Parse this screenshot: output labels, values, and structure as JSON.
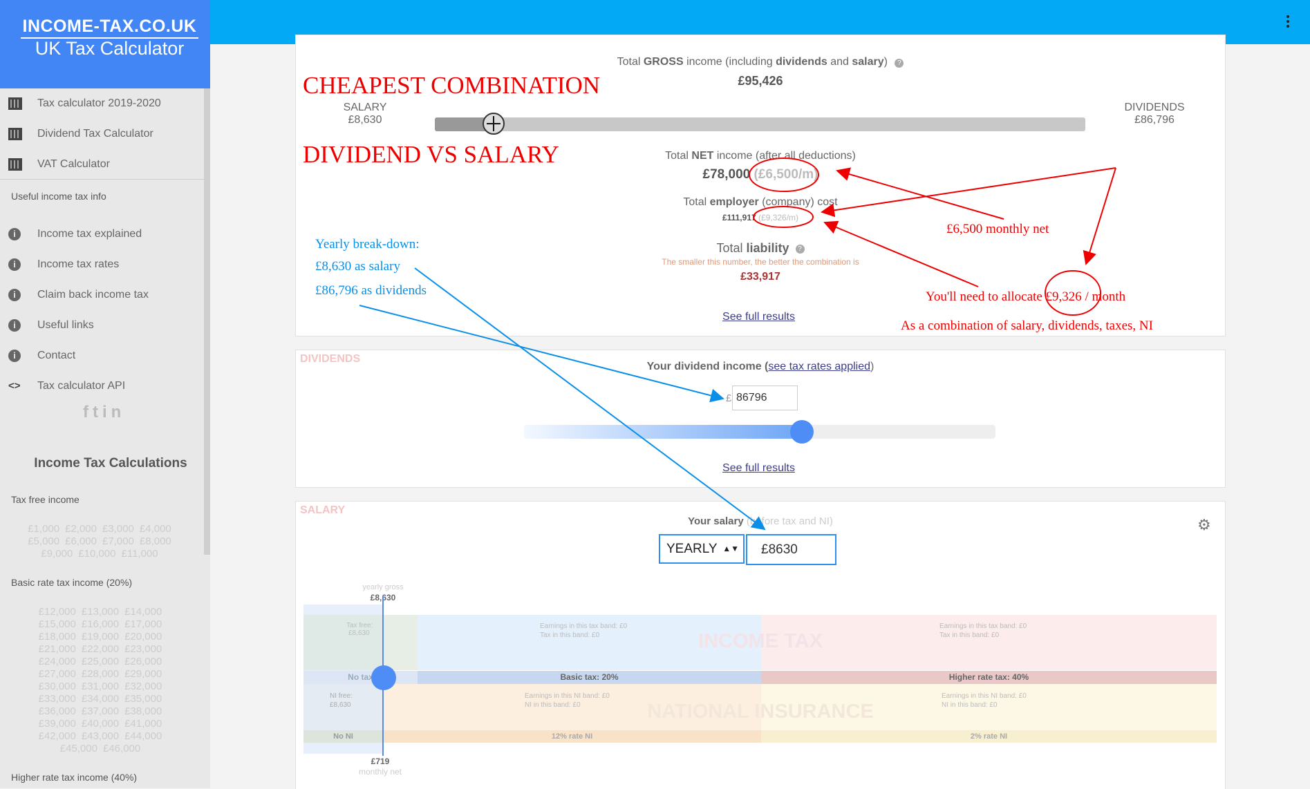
{
  "brand": {
    "line1": "INCOME-TAX.CO.UK",
    "line2": "UK Tax Calculator"
  },
  "nav": {
    "items": [
      {
        "label": "Tax calculator 2019-2020",
        "icon": "building-icon"
      },
      {
        "label": "Dividend Tax Calculator",
        "icon": "building-icon"
      },
      {
        "label": "VAT Calculator",
        "icon": "building-icon"
      }
    ],
    "section_label": "Useful income tax info",
    "info_items": [
      {
        "label": "Income tax explained",
        "icon": "info-icon"
      },
      {
        "label": "Income tax rates",
        "icon": "info-icon"
      },
      {
        "label": "Claim back income tax",
        "icon": "info-icon"
      },
      {
        "label": "Useful links",
        "icon": "info-icon"
      },
      {
        "label": "Contact",
        "icon": "info-icon"
      },
      {
        "label": "Tax calculator API",
        "icon": "code-icon"
      }
    ]
  },
  "sidebar": {
    "calc_title": "Income Tax Calculations",
    "tax_free_label": "Tax free income",
    "tax_free_amounts": [
      "£1,000",
      "£2,000",
      "£3,000",
      "£4,000",
      "£5,000",
      "£6,000",
      "£7,000",
      "£8,000",
      "£9,000",
      "£10,000",
      "£11,000"
    ],
    "basic_label": "Basic rate tax income (20%)",
    "basic_amounts": [
      "£12,000",
      "£13,000",
      "£14,000",
      "£15,000",
      "£16,000",
      "£17,000",
      "£18,000",
      "£19,000",
      "£20,000",
      "£21,000",
      "£22,000",
      "£23,000",
      "£24,000",
      "£25,000",
      "£26,000",
      "£27,000",
      "£28,000",
      "£29,000",
      "£30,000",
      "£31,000",
      "£32,000",
      "£33,000",
      "£34,000",
      "£35,000",
      "£36,000",
      "£37,000",
      "£38,000",
      "£39,000",
      "£40,000",
      "£41,000",
      "£42,000",
      "£43,000",
      "£44,000",
      "£45,000",
      "£46,000"
    ],
    "higher_label": "Higher rate tax income (40%)"
  },
  "summary": {
    "gross_pre": "Total ",
    "gross_bold": "GROSS",
    "gross_mid": " income (including ",
    "gross_b2": "dividends",
    "gross_and": " and ",
    "gross_b3": "salary",
    "gross_post": ")",
    "gross_value": "£95,426",
    "salary_label": "SALARY",
    "salary_value": "£8,630",
    "dividends_label": "DIVIDENDS",
    "dividends_value": "£86,796",
    "split_fraction": 0.09,
    "net_pre": "Total ",
    "net_bold": "NET",
    "net_post": " income (after all deductions)",
    "net_value": "£78,000",
    "net_monthly": "(£6,500/m)",
    "employer_pre": "Total ",
    "employer_bold": "employer",
    "employer_post": " (company) cost",
    "employer_value": "£111,917",
    "employer_monthly": "(£9,326/m)",
    "liability_pre": "Total ",
    "liability_bold": "liability",
    "liability_note": "The smaller this number, the better the combination is",
    "liability_value": "£33,917",
    "see_full": "See full results"
  },
  "dividends": {
    "label": "DIVIDENDS",
    "title": "Your dividend income (",
    "link": "see tax rates applied",
    "title_end": ")",
    "currency": "£",
    "value": "86796",
    "slider_fraction": 0.59,
    "see_full": "See full results"
  },
  "salary": {
    "label": "SALARY",
    "title": "Your salary ",
    "subtitle": "(before tax and NI)",
    "period": "YEARLY",
    "value": "£8630",
    "yearly_gross_label": "yearly gross",
    "yearly_gross_value": "£8,630",
    "tax_free_label": "Tax free:",
    "tax_free_value": "£8,630",
    "band1_earn": "Earnings in this tax band: £0",
    "band1_tax": "Tax in this band: £0",
    "band2_earn": "Earnings in this tax band: £0",
    "band2_tax": "Tax in this band: £0",
    "income_tax_title": "INCOME TAX",
    "no_tax": "No tax",
    "basic_tax": "Basic tax: 20%",
    "higher_tax": "Higher rate tax: 40%",
    "ni_free_label": "NI free:",
    "ni_free_value": "£8,630",
    "ni1_earn": "Earnings in this NI band: £0",
    "ni1_tax": "NI in this band: £0",
    "ni2_earn": "Earnings in this NI band: £0",
    "ni2_tax": "NI in this band: £0",
    "ni_title": "NATIONAL INSURANCE",
    "no_ni": "No NI",
    "ni_12": "12% rate NI",
    "ni_2": "2% rate NI",
    "monthly_value": "£719",
    "monthly_label": "monthly net"
  },
  "annotations": {
    "headline1": "CHEAPEST COMBINATION",
    "headline2": "DIVIDEND VS SALARY",
    "breakdown_title": "Yearly break-down:",
    "breakdown_salary": "£8,630 as salary",
    "breakdown_dividends": "£86,796 as dividends",
    "monthly_net": "£6,500 monthly net",
    "allocate_pre": "You'll need to allocate ",
    "allocate_value": "£9,326 /",
    "allocate_post": " month",
    "combination": "As a combination of salary, dividends, taxes, NI"
  },
  "colors": {
    "topbar": "#03a9f4",
    "brand": "#4285f4",
    "annotation_red": "#e00000",
    "annotation_blue": "#0a8fe8"
  }
}
